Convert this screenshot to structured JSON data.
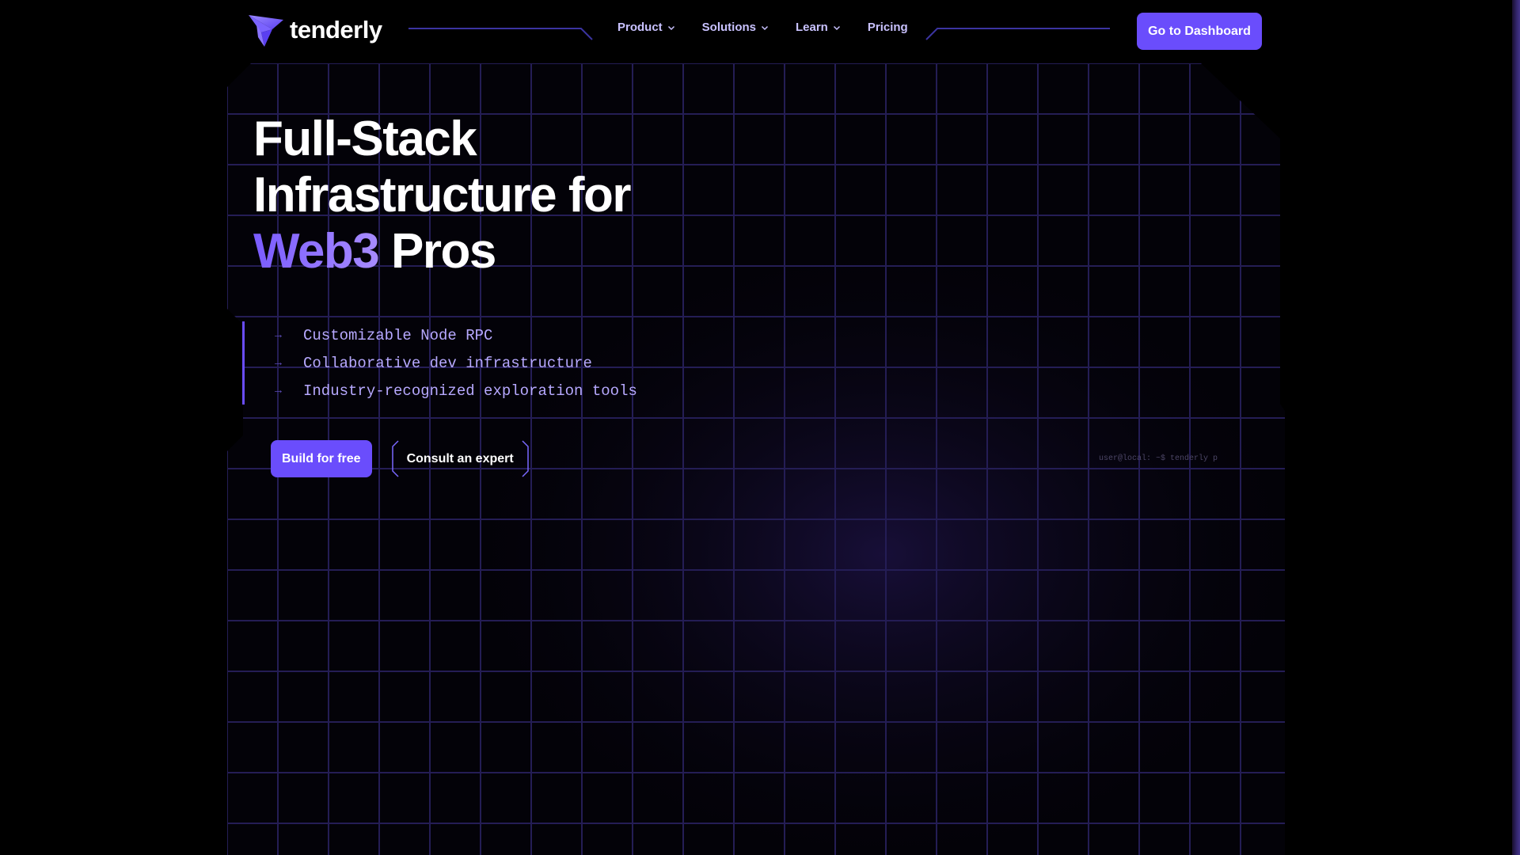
{
  "header": {
    "logo_text": "tenderly",
    "nav": [
      {
        "label": "Product",
        "has_dropdown": true
      },
      {
        "label": "Solutions",
        "has_dropdown": true
      },
      {
        "label": "Learn",
        "has_dropdown": true
      },
      {
        "label": "Pricing",
        "has_dropdown": false
      }
    ],
    "cta_label": "Go to Dashboard"
  },
  "hero": {
    "title_line1": "Full-Stack",
    "title_line2": "Infrastructure for",
    "title_accent": "Web3",
    "title_tail": " Pros",
    "features": [
      "Customizable Node RPC",
      "Collaborative dev infrastructure",
      "Industry-recognized exploration tools"
    ],
    "feature_arrow": "→",
    "primary_button": "Build for free",
    "secondary_button": "Consult an expert",
    "terminal_text": "user@local: ~$ tenderly p"
  },
  "colors": {
    "background": "#000000",
    "accent": "#6a4dfc",
    "nav_text": "#c9c2ff",
    "feature_text": "#b7a9ff",
    "grid_line": "#2a2260"
  },
  "icons": {
    "logo": "tenderly-logo-icon",
    "dropdown": "chevron-down-icon",
    "feature_bullet": "arrow-right-icon"
  }
}
